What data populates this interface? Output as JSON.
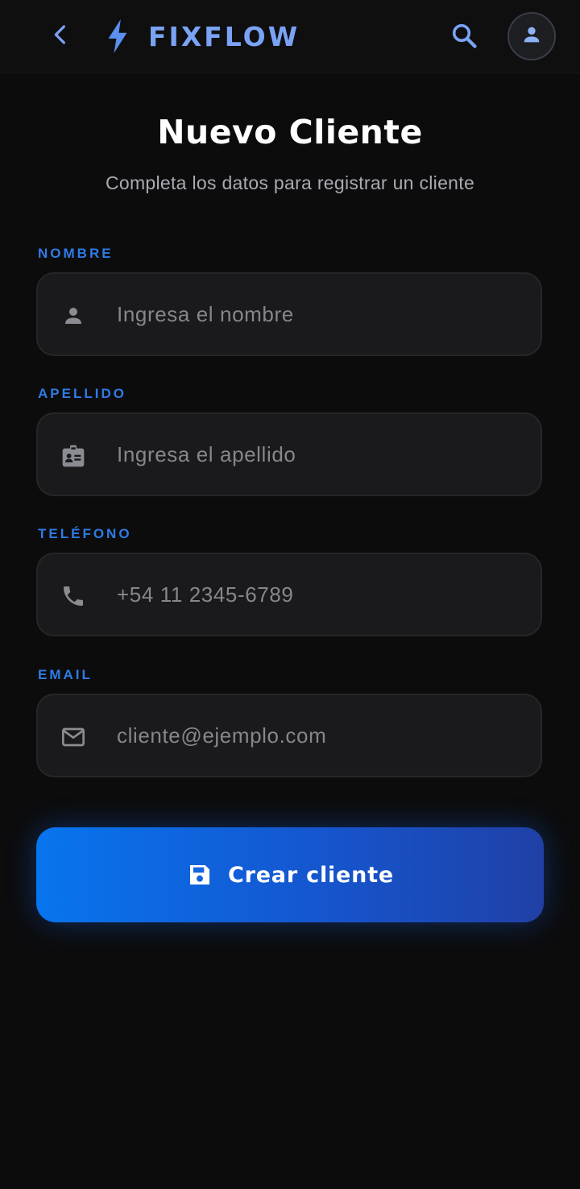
{
  "header": {
    "brand_name": "FIXFLOW",
    "back_icon": "chevron-left-icon",
    "brand_icon": "bolt-icon",
    "search_icon": "search-icon",
    "avatar_icon": "person-icon"
  },
  "page": {
    "title": "Nuevo Cliente",
    "subtitle": "Completa los datos para registrar un cliente"
  },
  "form": {
    "fields": [
      {
        "label": "NOMBRE",
        "placeholder": "Ingresa el nombre",
        "value": "",
        "icon": "person-icon"
      },
      {
        "label": "APELLIDO",
        "placeholder": "Ingresa el apellido",
        "value": "",
        "icon": "id-badge-icon"
      },
      {
        "label": "TELÉFONO",
        "placeholder": "+54 11 2345-6789",
        "value": "",
        "icon": "phone-icon"
      },
      {
        "label": "EMAIL",
        "placeholder": "cliente@ejemplo.com",
        "value": "",
        "icon": "mail-icon"
      }
    ],
    "submit": {
      "label": "Crear cliente",
      "icon": "save-icon"
    }
  },
  "colors": {
    "background": "#0c0c0d",
    "accent": "#2f7be6",
    "brand": "#7aa3f5",
    "field_bg": "#1a1a1c",
    "button_gradient_start": "#0775ee",
    "button_gradient_end": "#2040a6"
  }
}
